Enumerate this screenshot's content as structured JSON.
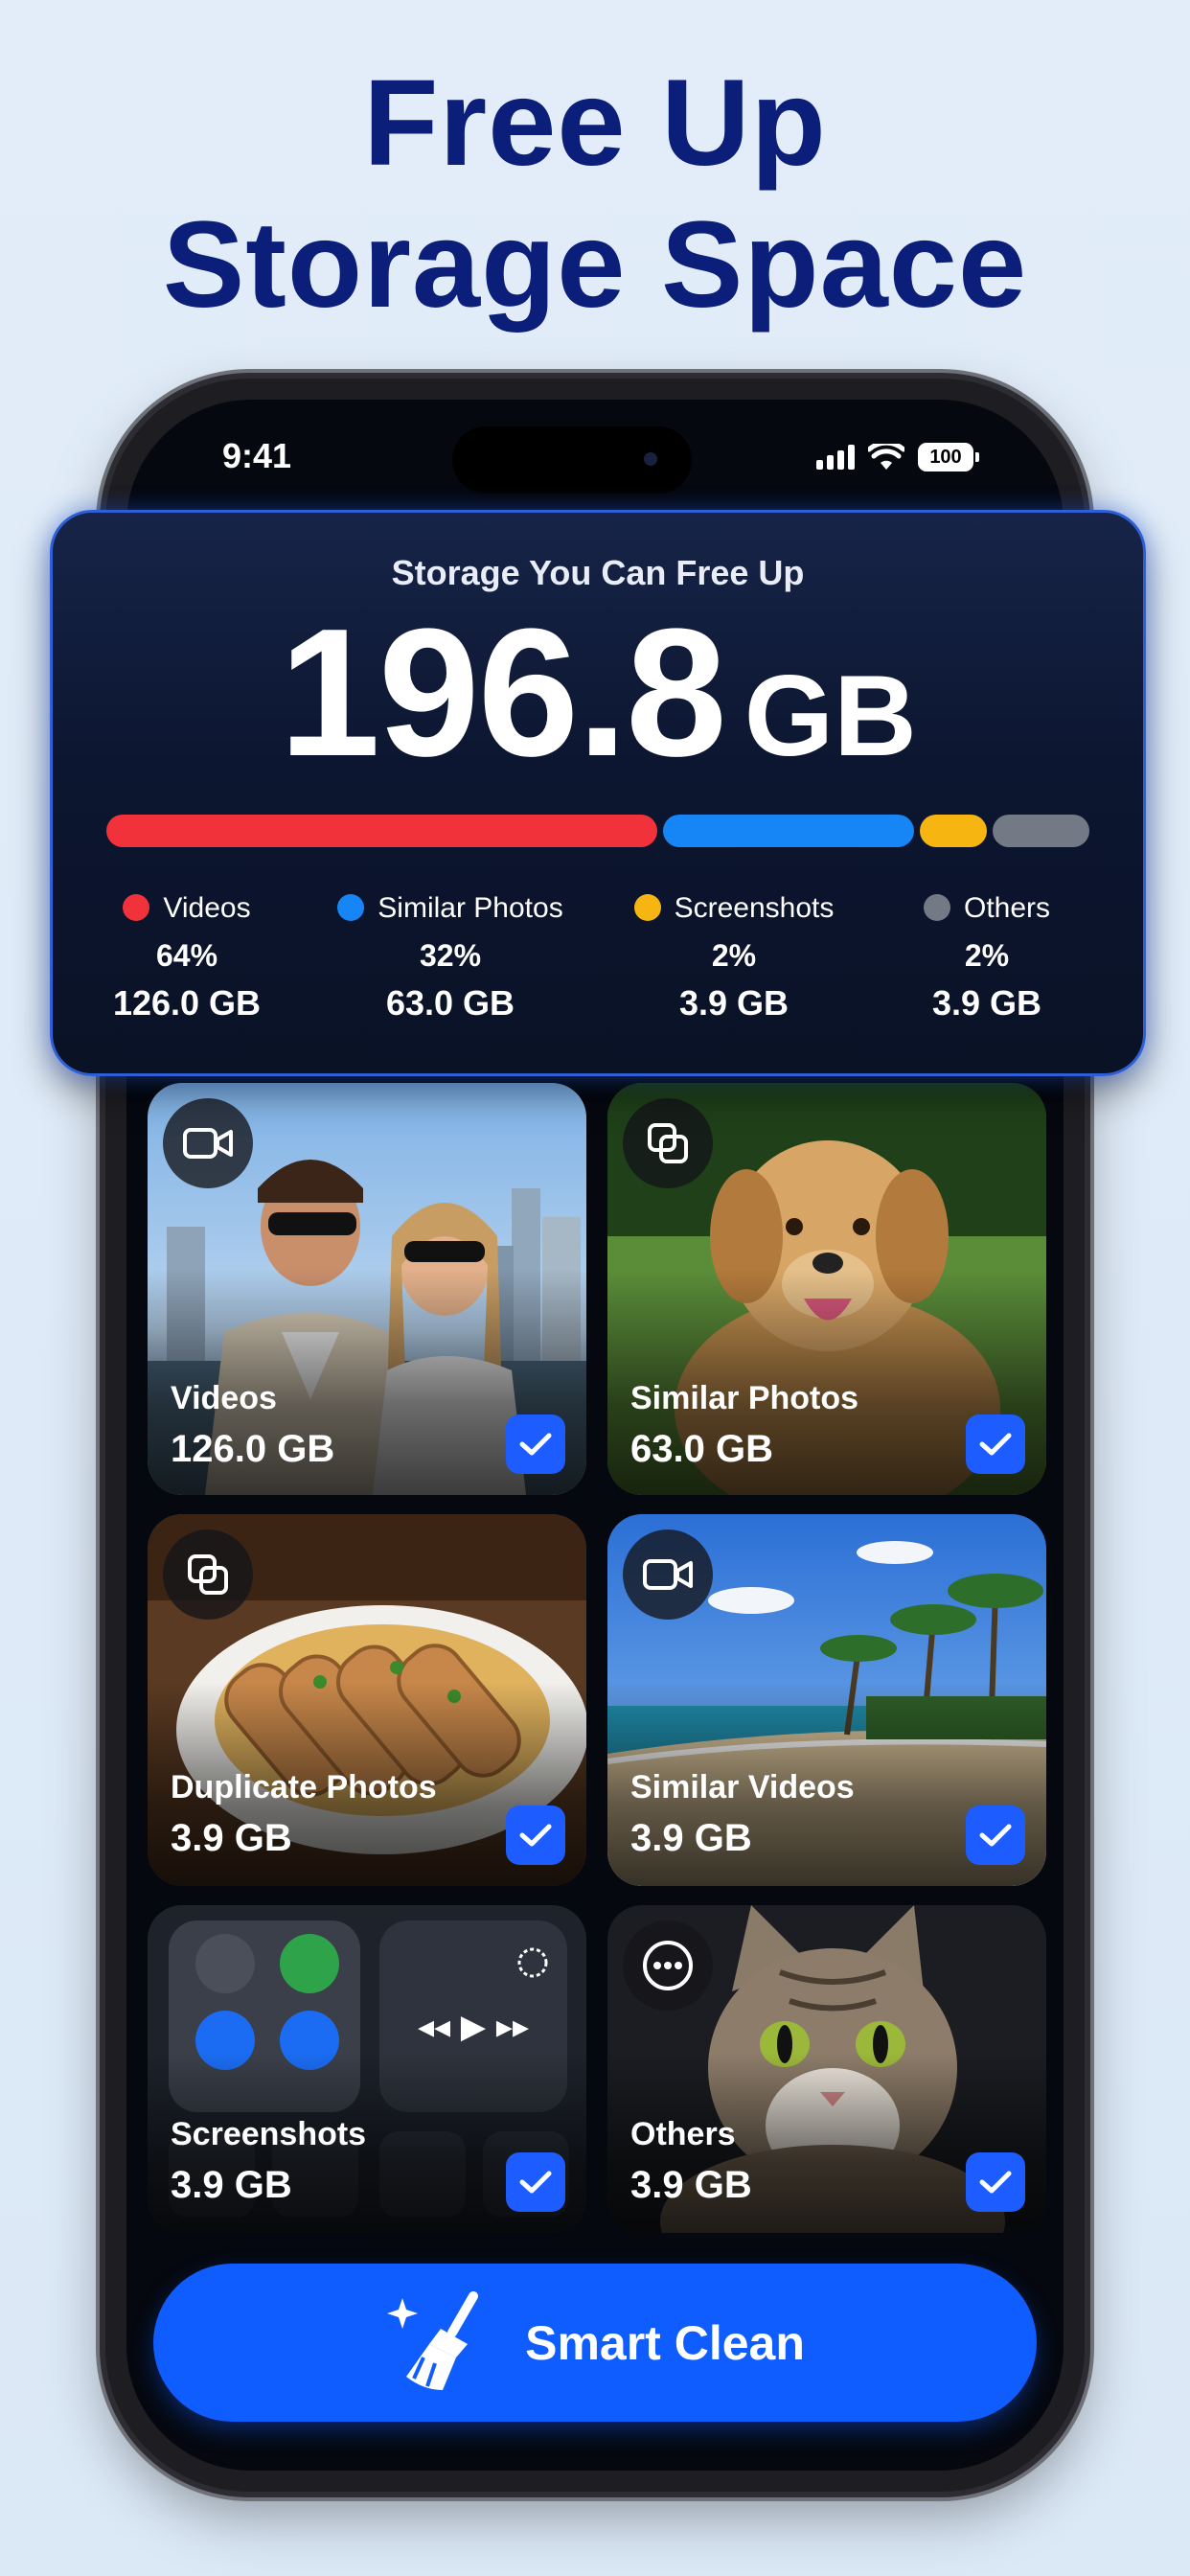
{
  "headline": {
    "line1": "Free Up",
    "line2": "Storage Space"
  },
  "status_bar": {
    "time": "9:41",
    "battery": "100"
  },
  "storage_card": {
    "title": "Storage You Can Free Up",
    "amount": "196.8",
    "unit": "GB",
    "segments": [
      {
        "label": "Videos",
        "percent": "64%",
        "size": "126.0 GB",
        "color": "#f1323a",
        "fraction": 0.57
      },
      {
        "label": "Similar Photos",
        "percent": "32%",
        "size": "63.0 GB",
        "color": "#1686f7",
        "fraction": 0.26
      },
      {
        "label": "Screenshots",
        "percent": "2%",
        "size": "3.9 GB",
        "color": "#f6b511",
        "fraction": 0.07
      },
      {
        "label": "Others",
        "percent": "2%",
        "size": "3.9 GB",
        "color": "#737a86",
        "fraction": 0.1
      }
    ]
  },
  "categories": [
    {
      "name": "Videos",
      "size": "126.0 GB",
      "icon": "video-camera-icon",
      "checked": true
    },
    {
      "name": "Similar Photos",
      "size": "63.0 GB",
      "icon": "similar-photos-icon",
      "checked": true
    },
    {
      "name": "Duplicate Photos",
      "size": "3.9 GB",
      "icon": "duplicate-photos-icon",
      "checked": true
    },
    {
      "name": "Similar Videos",
      "size": "3.9 GB",
      "icon": "video-camera-icon",
      "checked": true
    },
    {
      "name": "Screenshots",
      "size": "3.9 GB",
      "icon": "screenshot-icon",
      "checked": true
    },
    {
      "name": "Others",
      "size": "3.9 GB",
      "icon": "more-icon",
      "checked": true
    }
  ],
  "action_button": {
    "label": "Smart Clean",
    "icon": "broom-sparkle-icon"
  }
}
